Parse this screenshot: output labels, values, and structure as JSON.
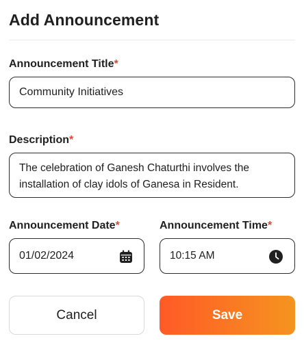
{
  "header": {
    "title": "Add Announcement"
  },
  "fields": {
    "title": {
      "label": "Announcement Title",
      "required_mark": "*",
      "value": "Community Initiatives"
    },
    "description": {
      "label": "Description",
      "required_mark": "*",
      "value": "The celebration of Ganesh Chaturthi involves the installation of clay idols of Ganesa in Resident."
    },
    "date": {
      "label": "Announcement Date",
      "required_mark": "*",
      "value": "01/02/2024",
      "icon": "calendar-icon"
    },
    "time": {
      "label": "Announcement Time",
      "required_mark": "*",
      "value": "10:15 AM",
      "icon": "clock-icon"
    }
  },
  "actions": {
    "cancel_label": "Cancel",
    "save_label": "Save"
  },
  "colors": {
    "accent_start": "#ff5a26",
    "accent_end": "#f5941f",
    "required": "#e8433a",
    "text": "#202020",
    "border": "#2b2b2b"
  }
}
